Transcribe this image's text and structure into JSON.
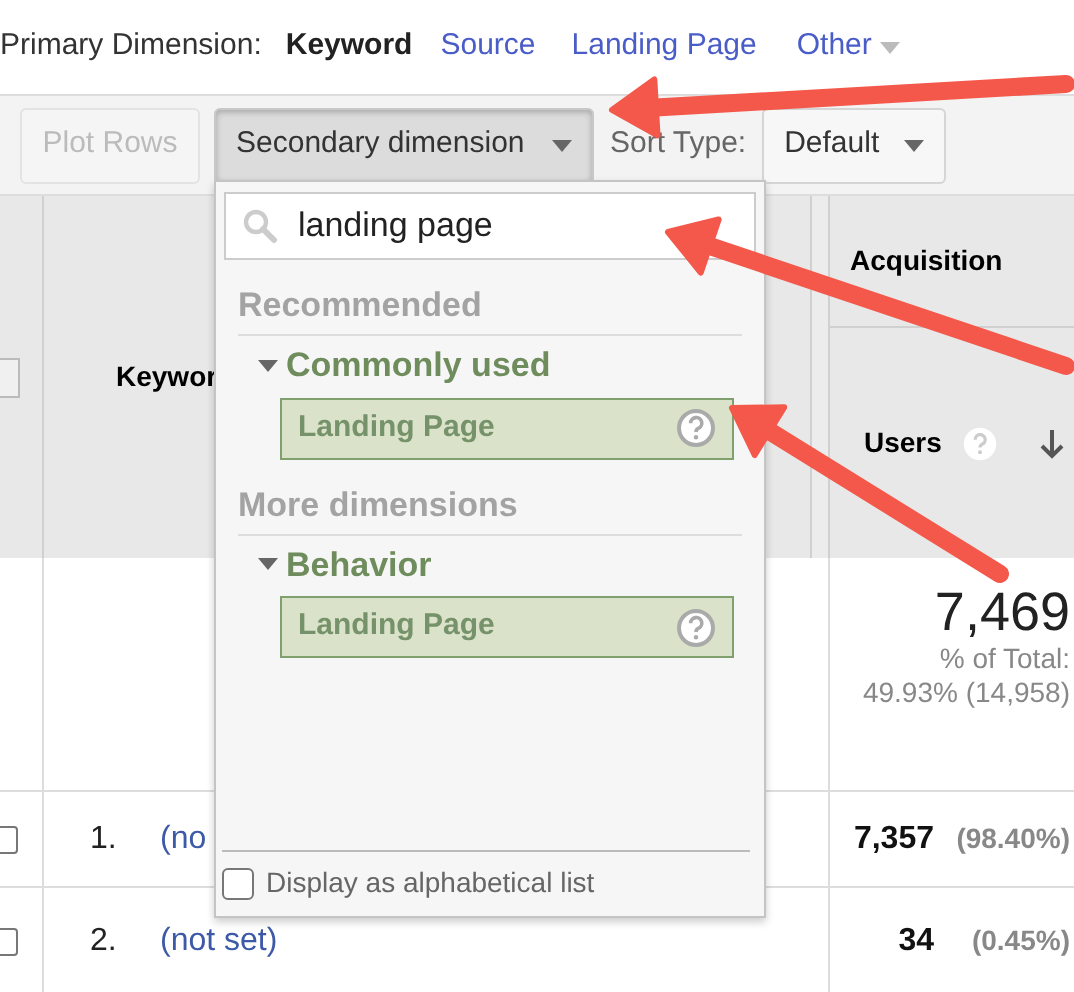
{
  "primary_dimension": {
    "label": "Primary Dimension:",
    "options": [
      {
        "label": "Keyword",
        "selected": true,
        "kind": "link"
      },
      {
        "label": "Source",
        "selected": false,
        "kind": "link"
      },
      {
        "label": "Landing Page",
        "selected": false,
        "kind": "link"
      },
      {
        "label": "Other",
        "selected": false,
        "kind": "menu"
      }
    ]
  },
  "toolbar": {
    "plot_rows": {
      "label": "Plot Rows",
      "disabled": true
    },
    "secondary_dimension": {
      "label": "Secondary dimension",
      "expanded": true
    },
    "sort_type": {
      "label": "Sort Type:",
      "value": "Default"
    }
  },
  "table": {
    "header": {
      "checked": false,
      "keyword": "Keywor",
      "group": "Acquisition",
      "metric": "Users"
    },
    "totals": {
      "value": "7,469",
      "share_label": "% of Total:",
      "share": "49.93% (14,958)"
    },
    "rows": [
      {
        "checked": false,
        "index": "1.",
        "keyword": "(no",
        "users": "7,357",
        "percent": "(98.40%)"
      },
      {
        "checked": false,
        "index": "2.",
        "keyword": "(not set)",
        "users": "34",
        "percent": "(0.45%)"
      }
    ]
  },
  "dropdown": {
    "search": {
      "value": "landing page"
    },
    "sections": [
      {
        "title": "Recommended",
        "groups": [
          {
            "name": "Commonly used",
            "expanded": true,
            "items": [
              "Landing Page"
            ]
          }
        ]
      },
      {
        "title": "More dimensions",
        "groups": [
          {
            "name": "Behavior",
            "expanded": true,
            "items": [
              "Landing Page"
            ]
          }
        ]
      }
    ],
    "alphabetical": {
      "label": "Display as alphabetical list",
      "checked": false
    }
  }
}
